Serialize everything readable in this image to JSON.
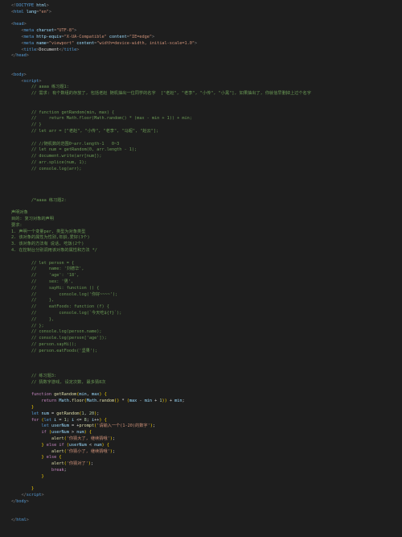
{
  "lines": [
    {
      "i": 0,
      "s": [
        [
          "pu",
          "<!"
        ],
        [
          "tg",
          "DOCTYPE"
        ],
        [
          "",
          ""
        ],
        [
          "at",
          " html"
        ],
        [
          "pu",
          ">"
        ]
      ]
    },
    {
      "i": 0,
      "s": [
        [
          "pu",
          "<"
        ],
        [
          "tg",
          "html"
        ],
        [
          "",
          ""
        ],
        [
          "at",
          " lang"
        ],
        [
          "pu",
          "="
        ],
        [
          "st",
          "\"en\""
        ],
        [
          "pu",
          ">"
        ]
      ]
    },
    {
      "i": 0,
      "s": [
        [
          "",
          ""
        ]
      ]
    },
    {
      "i": 0,
      "s": [
        [
          "pu",
          "<"
        ],
        [
          "tg",
          "head"
        ],
        [
          "pu",
          ">"
        ]
      ]
    },
    {
      "i": 1,
      "s": [
        [
          "pu",
          "<"
        ],
        [
          "tg",
          "meta"
        ],
        [
          "",
          ""
        ],
        [
          "at",
          " charset"
        ],
        [
          "pu",
          "="
        ],
        [
          "st",
          "\"UTF-8\""
        ],
        [
          "pu",
          ">"
        ]
      ]
    },
    {
      "i": 1,
      "s": [
        [
          "pu",
          "<"
        ],
        [
          "tg",
          "meta"
        ],
        [
          "",
          ""
        ],
        [
          "at",
          " http-equiv"
        ],
        [
          "pu",
          "="
        ],
        [
          "st",
          "\"X-UA-Compatible\""
        ],
        [
          "",
          ""
        ],
        [
          "at",
          " content"
        ],
        [
          "pu",
          "="
        ],
        [
          "st",
          "\"IE=edge\""
        ],
        [
          "pu",
          ">"
        ]
      ]
    },
    {
      "i": 1,
      "s": [
        [
          "pu",
          "<"
        ],
        [
          "tg",
          "meta"
        ],
        [
          "",
          ""
        ],
        [
          "at",
          " name"
        ],
        [
          "pu",
          "="
        ],
        [
          "st",
          "\"viewport\""
        ],
        [
          "",
          ""
        ],
        [
          "at",
          " content"
        ],
        [
          "pu",
          "="
        ],
        [
          "st",
          "\"width=device-width, initial-scale=1.0\""
        ],
        [
          "pu",
          ">"
        ]
      ]
    },
    {
      "i": 1,
      "s": [
        [
          "pu",
          "<"
        ],
        [
          "tg",
          "title"
        ],
        [
          "pu",
          ">"
        ],
        [
          "",
          "Document"
        ],
        [
          "pu",
          "</"
        ],
        [
          "tg",
          "title"
        ],
        [
          "pu",
          ">"
        ]
      ]
    },
    {
      "i": 0,
      "s": [
        [
          "pu",
          "</"
        ],
        [
          "tg",
          "head"
        ],
        [
          "pu",
          ">"
        ]
      ]
    },
    {
      "i": 0,
      "s": [
        [
          "",
          ""
        ]
      ]
    },
    {
      "i": 0,
      "s": [
        [
          "",
          ""
        ]
      ]
    },
    {
      "i": 0,
      "s": [
        [
          "pu",
          "<"
        ],
        [
          "tg",
          "body"
        ],
        [
          "pu",
          ">"
        ]
      ]
    },
    {
      "i": 1,
      "s": [
        [
          "pu",
          "<"
        ],
        [
          "tg",
          "script"
        ],
        [
          "pu",
          ">"
        ]
      ]
    },
    {
      "i": 2,
      "s": [
        [
          "cm",
          "// aaaa 练习题1:"
        ]
      ]
    },
    {
      "i": 2,
      "s": [
        [
          "cm",
          "// 需求: 有个数组的存放了, 包括老赵 随机抽出一位同学的名字  [\"老赵\", \"老李\", \"小传\", \"小黑\"], 如果抽出了, 你就信早删掉上过个名字"
        ]
      ]
    },
    {
      "i": 0,
      "s": [
        [
          "",
          ""
        ]
      ]
    },
    {
      "i": 0,
      "s": [
        [
          "",
          ""
        ]
      ]
    },
    {
      "i": 2,
      "s": [
        [
          "cm",
          "// function getRandom(min, max) {"
        ]
      ]
    },
    {
      "i": 2,
      "s": [
        [
          "cm",
          "//     return Math.floor(Math.random() * (max - min + 1)) + min;"
        ]
      ]
    },
    {
      "i": 2,
      "s": [
        [
          "cm",
          "// }"
        ]
      ]
    },
    {
      "i": 2,
      "s": [
        [
          "cm",
          "// let arr = [\"老赵\", \"小传\", \"老李\", \"马超\", \"赵云\"];"
        ]
      ]
    },
    {
      "i": 0,
      "s": [
        [
          "",
          ""
        ]
      ]
    },
    {
      "i": 2,
      "s": [
        [
          "cm",
          "// //随机数的范围0~arr.length-1   0~3"
        ]
      ]
    },
    {
      "i": 2,
      "s": [
        [
          "cm",
          "// let num = getRandom(0, arr.length - 1);"
        ]
      ]
    },
    {
      "i": 2,
      "s": [
        [
          "cm",
          "// document.write(arr[num]);"
        ]
      ]
    },
    {
      "i": 2,
      "s": [
        [
          "cm",
          "// arr.splice(num, 1);"
        ]
      ]
    },
    {
      "i": 2,
      "s": [
        [
          "cm",
          "// console.log(arr);"
        ]
      ]
    },
    {
      "i": 0,
      "s": [
        [
          "",
          ""
        ]
      ]
    },
    {
      "i": 0,
      "s": [
        [
          "",
          ""
        ]
      ]
    },
    {
      "i": 0,
      "s": [
        [
          "",
          ""
        ]
      ]
    },
    {
      "i": 0,
      "s": [
        [
          "",
          ""
        ]
      ]
    },
    {
      "i": 2,
      "s": [
        [
          "cm",
          "/*aaaa 练习题2:"
        ]
      ]
    },
    {
      "i": 0,
      "s": [
        [
          "",
          ""
        ]
      ]
    },
    {
      "i": 0,
      "s": [
        [
          "cm",
          "声明对象"
        ]
      ]
    },
    {
      "i": 0,
      "s": [
        [
          "cm",
          "目的: 复习对象的声明"
        ]
      ]
    },
    {
      "i": 0,
      "s": [
        [
          "cm",
          "要求:"
        ]
      ]
    },
    {
      "i": 0,
      "s": [
        [
          "cm",
          "1. 声明一个变量per, 类型为对象类型"
        ]
      ]
    },
    {
      "i": 0,
      "s": [
        [
          "cm",
          "2. 该对象的属性为性别,年龄,爱好(3个)"
        ]
      ]
    },
    {
      "i": 0,
      "s": [
        [
          "cm",
          "3. 该对象的方法有 说话, 吃饭(2个)"
        ]
      ]
    },
    {
      "i": 0,
      "s": [
        [
          "cm",
          "4. 在控制台分别调用该对象的属性和方法 */"
        ]
      ]
    },
    {
      "i": 0,
      "s": [
        [
          "",
          ""
        ]
      ]
    },
    {
      "i": 2,
      "s": [
        [
          "cm",
          "// let person = {"
        ]
      ]
    },
    {
      "i": 2,
      "s": [
        [
          "cm",
          "//     name: '刘德华',"
        ]
      ]
    },
    {
      "i": 2,
      "s": [
        [
          "cm",
          "//     'age': '18',"
        ]
      ]
    },
    {
      "i": 2,
      "s": [
        [
          "cm",
          "//     sex: '男',"
        ]
      ]
    },
    {
      "i": 2,
      "s": [
        [
          "cm",
          "//     sayHi: function () {"
        ]
      ]
    },
    {
      "i": 2,
      "s": [
        [
          "cm",
          "//         console.log('你好~~~~');"
        ]
      ]
    },
    {
      "i": 2,
      "s": [
        [
          "cm",
          "//     },"
        ]
      ]
    },
    {
      "i": 2,
      "s": [
        [
          "cm",
          "//     eatFoods: function (f) {"
        ]
      ]
    },
    {
      "i": 2,
      "s": [
        [
          "cm",
          "//         console.log(`今天吃${f}`);"
        ]
      ]
    },
    {
      "i": 2,
      "s": [
        [
          "cm",
          "//     },"
        ]
      ]
    },
    {
      "i": 2,
      "s": [
        [
          "cm",
          "// };"
        ]
      ]
    },
    {
      "i": 2,
      "s": [
        [
          "cm",
          "// console.log(person.name);"
        ]
      ]
    },
    {
      "i": 2,
      "s": [
        [
          "cm",
          "// console.log(person['age']);"
        ]
      ]
    },
    {
      "i": 2,
      "s": [
        [
          "cm",
          "// person.sayHi();"
        ]
      ]
    },
    {
      "i": 2,
      "s": [
        [
          "cm",
          "// person.eatFoods('坚果');"
        ]
      ]
    },
    {
      "i": 0,
      "s": [
        [
          "",
          ""
        ]
      ]
    },
    {
      "i": 0,
      "s": [
        [
          "",
          ""
        ]
      ]
    },
    {
      "i": 0,
      "s": [
        [
          "",
          ""
        ]
      ]
    },
    {
      "i": 2,
      "s": [
        [
          "cm",
          "// 练习题3:"
        ]
      ]
    },
    {
      "i": 2,
      "s": [
        [
          "cm",
          "// 猜数字游戏, 设定次数, 最多猜8次"
        ]
      ]
    },
    {
      "i": 0,
      "s": [
        [
          "",
          ""
        ]
      ]
    },
    {
      "i": 2,
      "s": [
        [
          "kw",
          "function"
        ],
        [
          "",
          " "
        ],
        [
          "fn",
          "getRandom"
        ],
        [
          "br",
          "("
        ],
        [
          "at",
          "min"
        ],
        [
          "",
          ", "
        ],
        [
          "at",
          "max"
        ],
        [
          "br",
          ") {"
        ]
      ]
    },
    {
      "i": 3,
      "s": [
        [
          "kw",
          "return"
        ],
        [
          "",
          " "
        ],
        [
          "at",
          "Math"
        ],
        [
          "",
          "."
        ],
        [
          "fn",
          "floor"
        ],
        [
          "br",
          "("
        ],
        [
          "at",
          "Math"
        ],
        [
          "",
          "."
        ],
        [
          "fn",
          "random"
        ],
        [
          "br",
          "() "
        ],
        [
          "",
          "* "
        ],
        [
          "br",
          "("
        ],
        [
          "at",
          "max"
        ],
        [
          "",
          " - "
        ],
        [
          "at",
          "min"
        ],
        [
          "",
          " + "
        ],
        [
          "nm",
          "1"
        ],
        [
          "br",
          ")) "
        ],
        [
          "",
          "+ "
        ],
        [
          "at",
          "min"
        ],
        [
          "",
          ";"
        ]
      ]
    },
    {
      "i": 2,
      "s": [
        [
          "br",
          "}"
        ]
      ]
    },
    {
      "i": 2,
      "s": [
        [
          "tg",
          "let"
        ],
        [
          "",
          " "
        ],
        [
          "at",
          "num"
        ],
        [
          "",
          " = "
        ],
        [
          "fn",
          "getRandom"
        ],
        [
          "br",
          "("
        ],
        [
          "nm",
          "1"
        ],
        [
          "",
          ", "
        ],
        [
          "nm",
          "20"
        ],
        [
          "br",
          ")"
        ],
        [
          "",
          ";"
        ]
      ]
    },
    {
      "i": 2,
      "s": [
        [
          "kw",
          "for"
        ],
        [
          "",
          " "
        ],
        [
          "br",
          "("
        ],
        [
          "tg",
          "let"
        ],
        [
          "",
          " "
        ],
        [
          "at",
          "i"
        ],
        [
          "",
          " = "
        ],
        [
          "nm",
          "1"
        ],
        [
          "",
          "; "
        ],
        [
          "at",
          "i"
        ],
        [
          "",
          " <= "
        ],
        [
          "nm",
          "8"
        ],
        [
          "",
          "; "
        ],
        [
          "at",
          "i"
        ],
        [
          "",
          "++"
        ],
        [
          "br",
          ") {"
        ]
      ]
    },
    {
      "i": 3,
      "s": [
        [
          "tg",
          "let"
        ],
        [
          "",
          " "
        ],
        [
          "at",
          "userNum"
        ],
        [
          "",
          " = +"
        ],
        [
          "fn",
          "prompt"
        ],
        [
          "br",
          "("
        ],
        [
          "st",
          "'请输入一个(1-20)的数字'"
        ],
        [
          "br",
          ")"
        ],
        [
          "",
          ";"
        ]
      ]
    },
    {
      "i": 3,
      "s": [
        [
          "kw",
          "if"
        ],
        [
          "",
          " "
        ],
        [
          "br",
          "("
        ],
        [
          "at",
          "userNum"
        ],
        [
          "",
          " > "
        ],
        [
          "at",
          "num"
        ],
        [
          "br",
          ") {"
        ]
      ]
    },
    {
      "i": 4,
      "s": [
        [
          "fn",
          "alert"
        ],
        [
          "br",
          "("
        ],
        [
          "st",
          "'你猜大了, 继续猜哦'"
        ],
        [
          "br",
          ")"
        ],
        [
          "",
          ";"
        ]
      ]
    },
    {
      "i": 3,
      "s": [
        [
          "br",
          "}"
        ],
        [
          "",
          " "
        ],
        [
          "kw",
          "else if"
        ],
        [
          "",
          " "
        ],
        [
          "br",
          "("
        ],
        [
          "at",
          "userNum"
        ],
        [
          "",
          " < "
        ],
        [
          "at",
          "num"
        ],
        [
          "br",
          ") {"
        ]
      ]
    },
    {
      "i": 4,
      "s": [
        [
          "fn",
          "alert"
        ],
        [
          "br",
          "("
        ],
        [
          "st",
          "'你猜小了, 继续猜哦'"
        ],
        [
          "br",
          ")"
        ],
        [
          "",
          ";"
        ]
      ]
    },
    {
      "i": 3,
      "s": [
        [
          "br",
          "}"
        ],
        [
          "",
          " "
        ],
        [
          "kw",
          "else"
        ],
        [
          "",
          " "
        ],
        [
          "br",
          "{"
        ]
      ]
    },
    {
      "i": 4,
      "s": [
        [
          "fn",
          "alert"
        ],
        [
          "br",
          "("
        ],
        [
          "st",
          "'你猜对了'"
        ],
        [
          "br",
          ")"
        ],
        [
          "",
          ";"
        ]
      ]
    },
    {
      "i": 4,
      "s": [
        [
          "kw",
          "break"
        ],
        [
          "",
          ";"
        ]
      ]
    },
    {
      "i": 3,
      "s": [
        [
          "br",
          "}"
        ]
      ]
    },
    {
      "i": 0,
      "s": [
        [
          "",
          ""
        ]
      ]
    },
    {
      "i": 2,
      "s": [
        [
          "br",
          "}"
        ]
      ]
    },
    {
      "i": 1,
      "s": [
        [
          "pu",
          "</"
        ],
        [
          "tg",
          "script"
        ],
        [
          "pu",
          ">"
        ]
      ]
    },
    {
      "i": 0,
      "s": [
        [
          "pu",
          "</"
        ],
        [
          "tg",
          "body"
        ],
        [
          "pu",
          ">"
        ]
      ]
    },
    {
      "i": 0,
      "s": [
        [
          "",
          ""
        ]
      ]
    },
    {
      "i": 0,
      "s": [
        [
          "",
          ""
        ]
      ]
    },
    {
      "i": 0,
      "s": [
        [
          "pu",
          "</"
        ],
        [
          "tg",
          "html"
        ],
        [
          "pu",
          ">"
        ]
      ]
    }
  ]
}
